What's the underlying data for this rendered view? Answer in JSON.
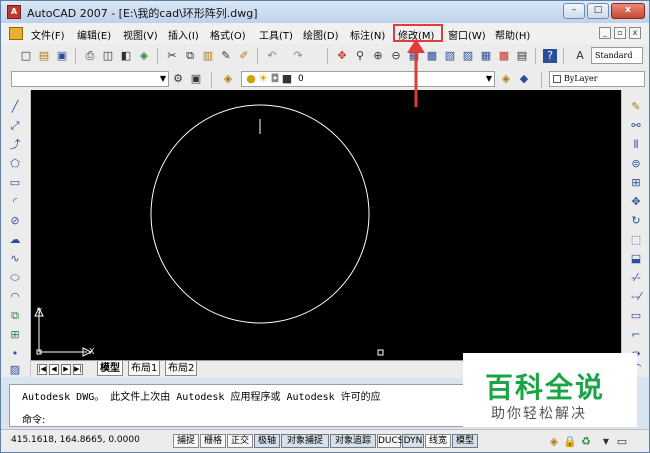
{
  "window": {
    "title": "AutoCAD 2007 - [E:\\我的cad\\环形阵列.dwg]",
    "app_icon": "autocad-logo",
    "controls": {
      "minimize": "–",
      "maximize": "□",
      "close": "x"
    }
  },
  "menu": {
    "items": [
      "文件(F)",
      "编辑(E)",
      "视图(V)",
      "插入(I)",
      "格式(O)",
      "工具(T)",
      "绘图(D)",
      "标注(N)",
      "修改(M)",
      "窗口(W)",
      "帮助(H)"
    ],
    "highlighted_item": "修改(M)",
    "highlight_color": "#e23b3b",
    "mdi_controls": [
      "_",
      "▫",
      "x"
    ]
  },
  "toolbar": {
    "text_style": "Standard",
    "layer_value": "0",
    "linetype_value": "ByLayer"
  },
  "drawing": {
    "background": "#000000",
    "entity": "circle",
    "ucs_y": "Y",
    "ucs_x": "X"
  },
  "layout_tabs": [
    "模型",
    "布局1",
    "布局2"
  ],
  "active_tab": "模型",
  "tab_nav": [
    "|◀",
    "◀",
    "▶",
    "▶|"
  ],
  "command": {
    "history": "Autodesk DWG。  此文件上次由 Autodesk 应用程序或 Autodesk 许可的应",
    "prompt": "命令:"
  },
  "status": {
    "coordinates": "415.1618, 164.8665, 0.0000",
    "toggles": [
      "捕捉",
      "栅格",
      "正交",
      "极轴",
      "对象捕捉",
      "对象追踪",
      "DUCS",
      "DYN",
      "线宽",
      "模型"
    ]
  },
  "watermark": {
    "title": "百科全说",
    "subtitle": "助你轻松解决",
    "color": "#1aa545"
  }
}
